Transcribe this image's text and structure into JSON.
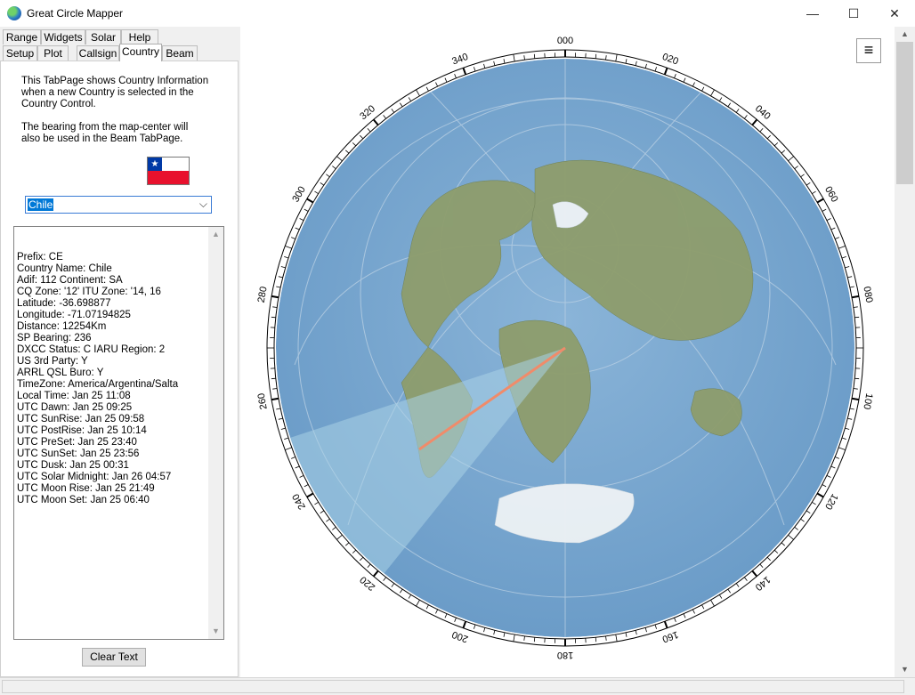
{
  "window": {
    "title": "Great Circle Mapper",
    "controls": {
      "minimize": "—",
      "maximize": "☐",
      "close": "✕"
    }
  },
  "tabs_row1": [
    {
      "label": "Range"
    },
    {
      "label": "Widgets"
    },
    {
      "label": "Solar"
    },
    {
      "label": "Help"
    }
  ],
  "tabs_row2": [
    {
      "label": "Setup"
    },
    {
      "label": "Plot"
    },
    {
      "label": "Callsign"
    },
    {
      "label": "Country"
    },
    {
      "label": "Beam"
    }
  ],
  "active_tab": "Country",
  "description": "This TabPage shows Country Information\nwhen a new Country is selected in the\nCountry Control.\n\nThe bearing from the map-center will\nalso be used in the Beam TabPage.",
  "flag": {
    "icon": "chile-flag",
    "star": "★"
  },
  "country_select": {
    "value": "Chile",
    "arrow": "⌵"
  },
  "country_info_lines": [
    "Prefix: CE",
    "Country Name: Chile",
    "Adif: 112  Continent: SA",
    "CQ Zone: '12'  ITU Zone: '14, 16",
    "Latitude: -36.698877",
    "Longitude: -71.07194825",
    "Distance: 12254Km",
    "SP Bearing: 236",
    "DXCC Status: C  IARU Region: 2",
    "US 3rd Party: Y",
    "ARRL QSL Buro: Y",
    "TimeZone: America/Argentina/Salta",
    "Local Time: Jan 25  11:08",
    "UTC Dawn: Jan 25  09:25",
    "UTC SunRise: Jan 25  09:58",
    "UTC PostRise: Jan 25  10:14",
    "UTC PreSet: Jan 25  23:40",
    "UTC SunSet: Jan 25  23:56",
    "UTC Dusk: Jan 25  00:31",
    "UTC Solar Midnight: Jan 26  04:57",
    "UTC Moon Rise: Jan 25  21:49",
    "UTC Moon Set: Jan 25  06:40"
  ],
  "clear_button": "Clear Text",
  "map": {
    "menu_icon": "≡",
    "bearing_labels": [
      "000",
      "020",
      "040",
      "060",
      "080",
      "100",
      "120",
      "140",
      "160",
      "180",
      "200",
      "220",
      "240",
      "260",
      "280",
      "300",
      "320",
      "340"
    ],
    "beam_bearing": 236,
    "colors": {
      "ocean": "#7ba7cf",
      "land": "#8a9b6a",
      "beam": "#a9d2e6",
      "path": "#f08b6a"
    }
  }
}
